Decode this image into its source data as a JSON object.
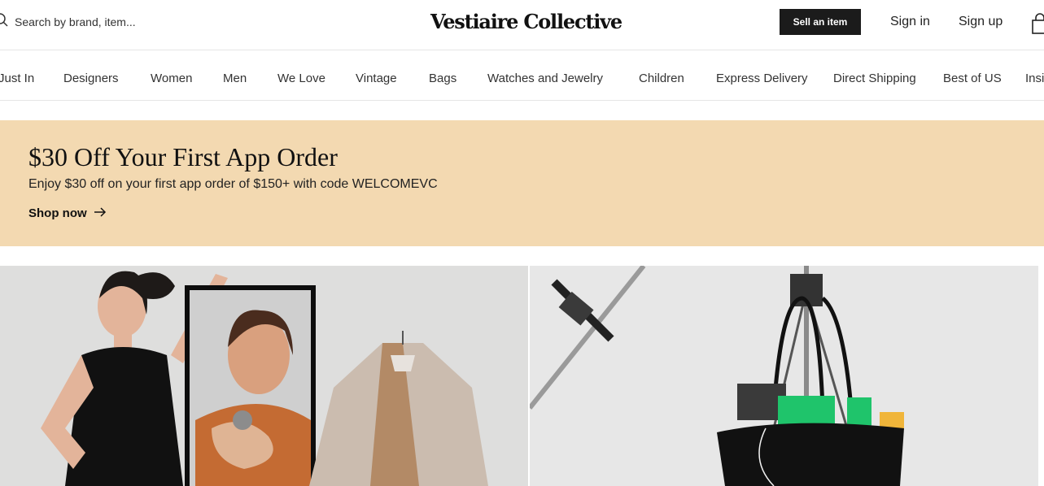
{
  "header": {
    "search_placeholder": "Search by brand, item...",
    "logo": "Vestiaire Collective",
    "sell_label": "Sell an item",
    "sign_in_label": "Sign in",
    "sign_up_label": "Sign up"
  },
  "nav": {
    "items": [
      "Just In",
      "Designers",
      "Women",
      "Men",
      "We Love",
      "Vintage",
      "Bags",
      "Watches and Jewelry",
      "Children",
      "Express Delivery",
      "Direct Shipping",
      "Best of US",
      "Insi"
    ]
  },
  "banner": {
    "title": "$30 Off Your First App Order",
    "subtitle": "Enjoy $30 off on your first app order of $150+ with code WELCOMEVC",
    "cta": "Shop now"
  },
  "colors": {
    "banner_bg": "#f3d9b1",
    "button_bg": "#1b1b1b",
    "text": "#1b1b1b"
  },
  "icons": [
    "search-icon",
    "shopping-bag-icon",
    "arrow-right-icon"
  ]
}
